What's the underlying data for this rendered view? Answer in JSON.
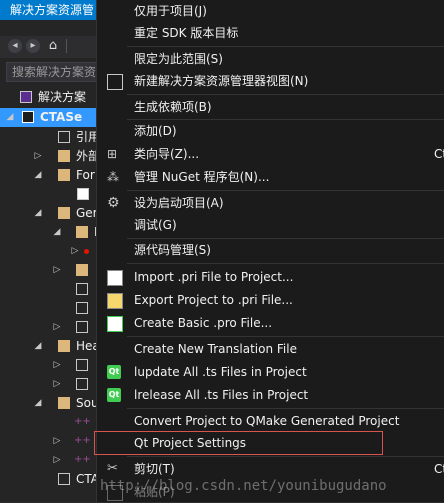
{
  "explorer": {
    "title": "解决方案资源管",
    "search_placeholder": "搜索解决方案资",
    "rows": [
      {
        "label": "解决方案"
      },
      {
        "label": "CTASe"
      },
      {
        "label": "引用"
      },
      {
        "label": "外部"
      },
      {
        "label": "For"
      },
      {
        "label": ""
      },
      {
        "label": "Ger"
      },
      {
        "label": "I"
      },
      {
        "label": ""
      },
      {
        "label": ""
      },
      {
        "label": ""
      },
      {
        "label": ""
      },
      {
        "label": ""
      },
      {
        "label": "Hea"
      },
      {
        "label": ""
      },
      {
        "label": ""
      },
      {
        "label": "Sou"
      },
      {
        "label": ""
      },
      {
        "label": ""
      },
      {
        "label": ""
      },
      {
        "label": "CTA"
      }
    ]
  },
  "menu": {
    "items": [
      {
        "label": "仅用于项目(J)",
        "icon": ""
      },
      {
        "label": "重定 SDK 版本目标",
        "icon": ""
      },
      {
        "label": "限定为此范围(S)",
        "icon": ""
      },
      {
        "label": "新建解决方案资源管理器视图(N)",
        "icon": "new-view-icon"
      },
      {
        "label": "生成依赖项(B)",
        "icon": ""
      },
      {
        "label": "添加(D)",
        "icon": ""
      },
      {
        "label": "类向导(Z)...",
        "icon": "class-wizard-icon",
        "shortcut": "Ct"
      },
      {
        "label": "管理 NuGet 程序包(N)...",
        "icon": "nuget-icon"
      },
      {
        "label": "设为启动项目(A)",
        "icon": "gear-icon"
      },
      {
        "label": "调试(G)",
        "icon": ""
      },
      {
        "label": "源代码管理(S)",
        "icon": ""
      },
      {
        "label": "Import .pri File to Project...",
        "icon": "import-pri-icon"
      },
      {
        "label": "Export Project to .pri File...",
        "icon": "export-pri-icon"
      },
      {
        "label": "Create Basic .pro File...",
        "icon": "create-pro-icon"
      },
      {
        "label": "Create New Translation File",
        "icon": ""
      },
      {
        "label": "lupdate All .ts Files in Project",
        "icon": "qt-lupdate-icon",
        "badge": "Qt"
      },
      {
        "label": "lrelease All .ts Files in Project",
        "icon": "qt-lrelease-icon",
        "badge": "Qt"
      },
      {
        "label": "Convert Project to QMake Generated Project",
        "icon": ""
      },
      {
        "label": "Qt Project Settings",
        "icon": ""
      },
      {
        "label": "剪切(T)",
        "icon": "cut-icon",
        "shortcut": "Ct"
      },
      {
        "label": "粘贴(P)",
        "icon": "paste-icon"
      }
    ]
  },
  "watermark": "http://blog.csdn.net/younibugudano",
  "colors": {
    "accent": "#007acc",
    "selection": "#3399ff",
    "highlight_border": "#d9534f",
    "menu_bg": "#1b1b1c",
    "qt_green": "#41cd52"
  }
}
